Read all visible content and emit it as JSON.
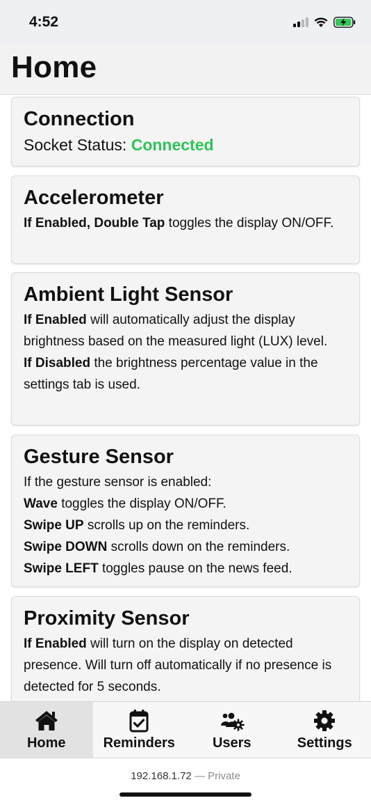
{
  "status_bar": {
    "time": "4:52"
  },
  "header": {
    "title": "Home"
  },
  "cards": {
    "connection": {
      "title": "Connection",
      "status_label": "Socket Status:",
      "status_value": "Connected",
      "status_color": "#2fc35a"
    },
    "accelerometer": {
      "title": "Accelerometer",
      "bold_1": "If Enabled, Double Tap",
      "text_1": " toggles the display ON/OFF."
    },
    "ambient": {
      "title": "Ambient Light Sensor",
      "bold_1": "If Enabled",
      "text_1": " will automatically adjust the display brightness based on the measured light (LUX) level.",
      "bold_2": "If Disabled",
      "text_2": " the brightness percentage value in the settings tab is used."
    },
    "gesture": {
      "title": "Gesture Sensor",
      "intro": "If the gesture sensor is enabled:",
      "lines": [
        {
          "bold": "Wave",
          "text": " toggles the display ON/OFF."
        },
        {
          "bold": "Swipe UP",
          "text": " scrolls up on the reminders."
        },
        {
          "bold": "Swipe DOWN",
          "text": " scrolls down on the reminders."
        },
        {
          "bold": "Swipe LEFT",
          "text": " toggles pause on the news feed."
        }
      ]
    },
    "proximity": {
      "title": "Proximity Sensor",
      "bold_1": "If Enabled",
      "text_1": " will turn on the display on detected presence. Will turn off automatically if no presence is detected for 5 seconds."
    }
  },
  "tabs": [
    {
      "label": "Home",
      "icon": "home-icon",
      "active": true
    },
    {
      "label": "Reminders",
      "icon": "calendar-check-icon",
      "active": false
    },
    {
      "label": "Users",
      "icon": "users-cog-icon",
      "active": false
    },
    {
      "label": "Settings",
      "icon": "gear-icon",
      "active": false
    }
  ],
  "browser": {
    "address": "192.168.1.72",
    "separator": " — ",
    "mode": "Private"
  }
}
